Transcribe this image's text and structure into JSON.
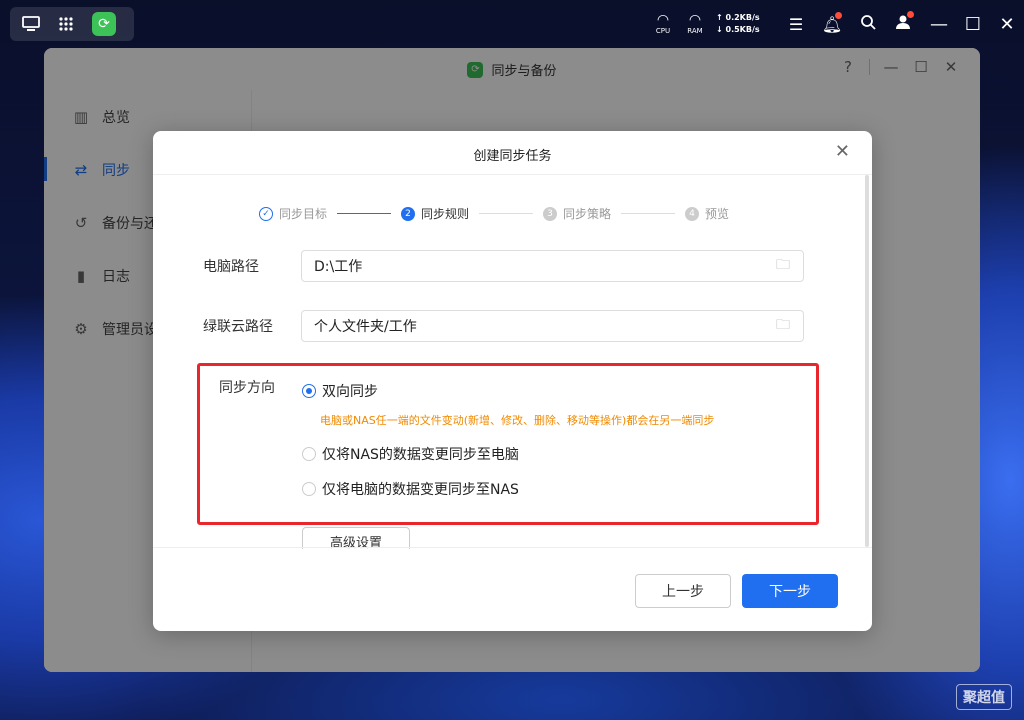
{
  "topbar": {
    "icons": [
      "desktop-icon",
      "grid-icon",
      "sync-app-icon"
    ],
    "cpu_label": "CPU",
    "ram_label": "RAM",
    "upload_speed": "0.2KB/s",
    "download_speed": "0.5KB/s",
    "right_icons": [
      "storage-icon",
      "bell-icon",
      "search-icon",
      "user-icon"
    ]
  },
  "app": {
    "title": "同步与备份",
    "help": "?",
    "sidebar": [
      {
        "label": "总览",
        "icon": "overview-icon",
        "active": false
      },
      {
        "label": "同步",
        "icon": "sync-icon",
        "active": true
      },
      {
        "label": "备份与还",
        "icon": "backup-icon",
        "active": false
      },
      {
        "label": "日志",
        "icon": "log-icon",
        "active": false
      },
      {
        "label": "管理员设",
        "icon": "admin-icon",
        "active": false
      }
    ]
  },
  "dialog": {
    "title": "创建同步任务",
    "steps": [
      {
        "num": "✓",
        "label": "同步目标",
        "state": "done"
      },
      {
        "num": "2",
        "label": "同步规则",
        "state": "current"
      },
      {
        "num": "3",
        "label": "同步策略",
        "state": "todo"
      },
      {
        "num": "4",
        "label": "预览",
        "state": "todo"
      }
    ],
    "pc_path_label": "电脑路径",
    "pc_path_value": "D:\\工作",
    "cloud_path_label": "绿联云路径",
    "cloud_path_value": "个人文件夹/工作",
    "direction_label": "同步方向",
    "options": [
      {
        "label": "双向同步",
        "selected": true
      },
      {
        "label": "仅将NAS的数据变更同步至电脑",
        "selected": false
      },
      {
        "label": "仅将电脑的数据变更同步至NAS",
        "selected": false
      }
    ],
    "option_hint": "电脑或NAS任一端的文件变动(新增、修改、删除、移动等操作)都会在另一端同步",
    "advanced_label": "高级设置",
    "prev_label": "上一步",
    "next_label": "下一步"
  },
  "watermark": "聚超值",
  "colors": {
    "accent": "#1f6ff0",
    "highlight": "#e8262c",
    "hint": "#f08a00"
  }
}
